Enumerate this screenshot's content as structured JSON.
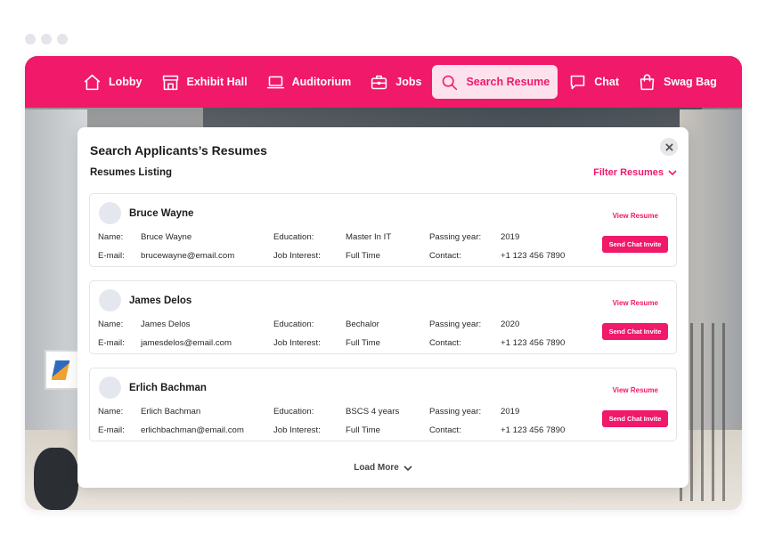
{
  "nav": {
    "items": [
      {
        "label": "Lobby",
        "icon": "home-icon",
        "active": false
      },
      {
        "label": "Exhibit Hall",
        "icon": "storefront-icon",
        "active": false
      },
      {
        "label": "Auditorium",
        "icon": "laptop-icon",
        "active": false
      },
      {
        "label": "Jobs",
        "icon": "briefcase-icon",
        "active": false
      },
      {
        "label": "Search Resume",
        "icon": "search-icon",
        "active": true
      },
      {
        "label": "Chat",
        "icon": "chat-icon",
        "active": false
      },
      {
        "label": "Swag Bag",
        "icon": "shopping-bag-icon",
        "active": false
      }
    ],
    "accent": "#f0196a"
  },
  "panel": {
    "title": "Search Applicants’s Resumes",
    "list_heading": "Resumes Listing",
    "filter_label": "Filter Resumes",
    "load_more": "Load More"
  },
  "field_labels": {
    "name": "Name:",
    "email": "E-mail:",
    "education": "Education:",
    "job_interest": "Job Interest:",
    "passing_year": "Passing year:",
    "contact": "Contact:",
    "view_resume": "View Resume",
    "send_invite": "Send Chat Invite"
  },
  "applicants": [
    {
      "display_name": "Bruce Wayne",
      "name": "Bruce Wayne",
      "email": "brucewayne@email.com",
      "education": "Master In IT",
      "job_interest": "Full Time",
      "passing_year": "2019",
      "contact": "+1 123 456 7890"
    },
    {
      "display_name": "James Delos",
      "name": "James Delos",
      "email": "jamesdelos@email.com",
      "education": "Bechalor",
      "job_interest": "Full Time",
      "passing_year": "2020",
      "contact": "+1 123 456 7890"
    },
    {
      "display_name": "Erlich Bachman",
      "name": "Erlich Bachman",
      "email": "erlichbachman@email.com",
      "education": "BSCS 4 years",
      "job_interest": "Full Time",
      "passing_year": "2019",
      "contact": "+1 123 456 7890"
    }
  ]
}
